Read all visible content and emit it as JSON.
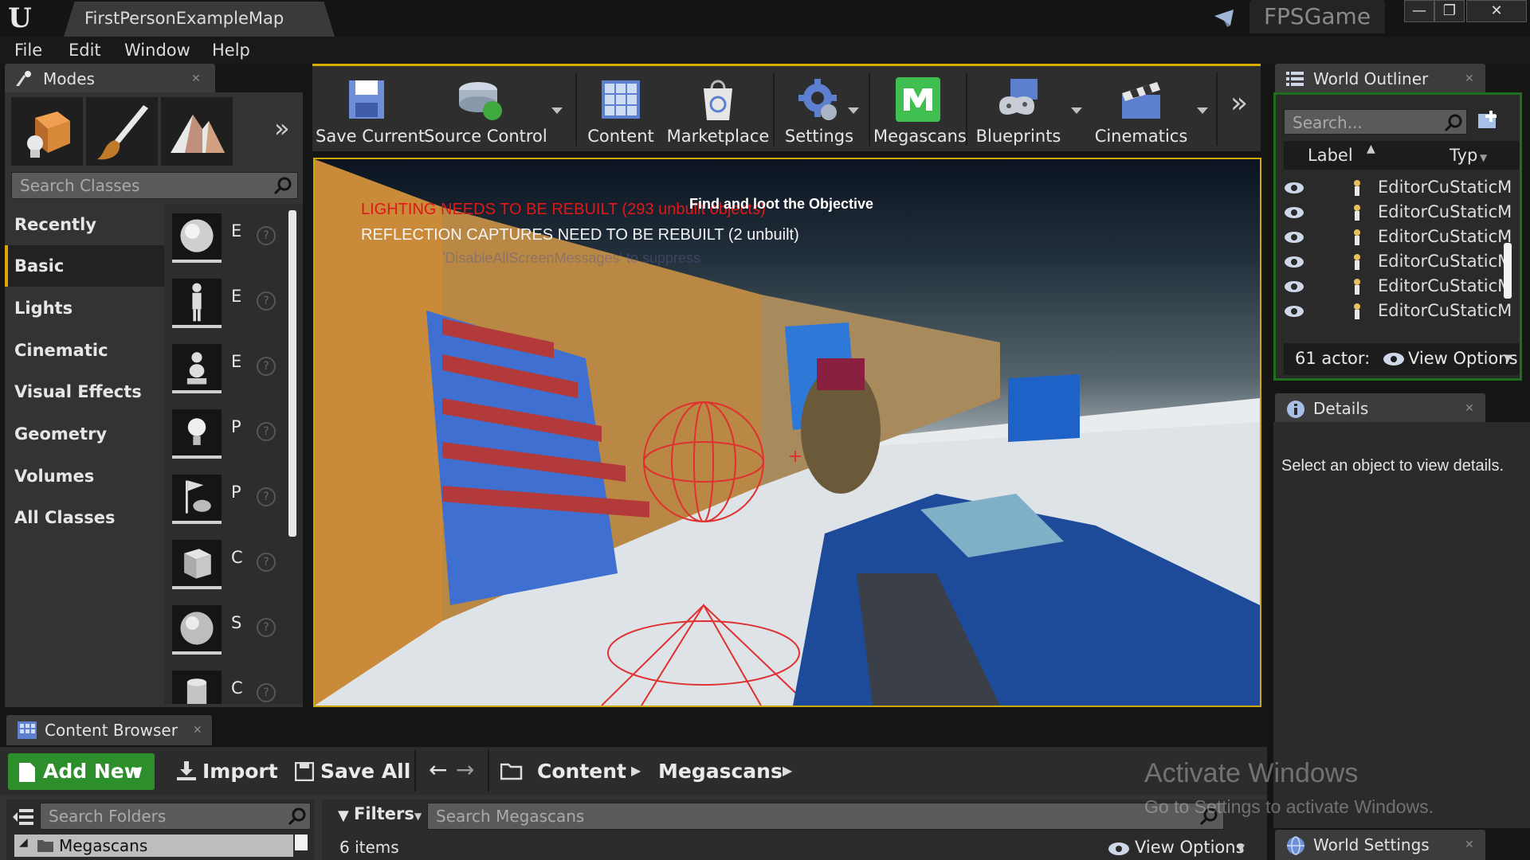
{
  "title_bar": {
    "logo": "U",
    "map_tab": "FirstPersonExampleMap",
    "project_name": "FPSGame",
    "window_buttons": [
      "—",
      "❐",
      "✕"
    ]
  },
  "menu": [
    "File",
    "Edit",
    "Window",
    "Help"
  ],
  "modes_panel": {
    "tab_label": "Modes",
    "search_placeholder": "Search Classes",
    "categories": [
      "Recently Placed",
      "Basic",
      "Lights",
      "Cinematic",
      "Visual Effects",
      "Geometry",
      "Volumes",
      "All Classes"
    ],
    "active_category": "Basic",
    "placeables": [
      "E",
      "E",
      "E",
      "P",
      "P",
      "C",
      "S",
      "C"
    ]
  },
  "toolbar": {
    "buttons": [
      "Save Current",
      "Source Control",
      "Content",
      "Marketplace",
      "Settings",
      "Megascans",
      "Blueprints",
      "Cinematics"
    ]
  },
  "viewport": {
    "warning_lighting": "LIGHTING NEEDS TO BE REBUILT (293 unbuilt objects)",
    "objective": "Find and loot the Objective",
    "warning_reflection": "REFLECTION CAPTURES NEED TO BE REBUILT (2 unbuilt)",
    "faint_hint": "'DisableAllScreenMessages' to suppress"
  },
  "world_outliner": {
    "tab_label": "World Outliner",
    "search_placeholder": "Search...",
    "columns": [
      "Label",
      "Typ"
    ],
    "rows": [
      {
        "label": "EditorCu",
        "type": "StaticM"
      },
      {
        "label": "EditorCu",
        "type": "StaticM"
      },
      {
        "label": "EditorCu",
        "type": "StaticM"
      },
      {
        "label": "EditorCu",
        "type": "StaticM"
      },
      {
        "label": "EditorCu",
        "type": "StaticM"
      },
      {
        "label": "EditorCu",
        "type": "StaticM"
      }
    ],
    "actor_count": "61 actor:",
    "view_options": "View Options"
  },
  "details": {
    "tab_label": "Details",
    "empty_message": "Select an object to view details."
  },
  "world_settings": {
    "tab_label": "World Settings"
  },
  "content_browser": {
    "tab_label": "Content Browser",
    "add_new": "Add New",
    "import": "Import",
    "save_all": "Save All",
    "path": [
      "Content",
      "Megascans"
    ],
    "search_folders_placeholder": "Search Folders",
    "folder": "Megascans",
    "filters": "Filters",
    "search_placeholder": "Search Megascans",
    "item_count": "6 items",
    "view_options": "View Options"
  },
  "watermark": {
    "line1": "Activate Windows",
    "line2": "Go to Settings to activate Windows."
  },
  "colors": {
    "accent_yellow": "#d8ad00",
    "outliner_border": "#1e6e1e",
    "add_new_green": "#2c8f2c",
    "warning_red": "#e01818"
  }
}
